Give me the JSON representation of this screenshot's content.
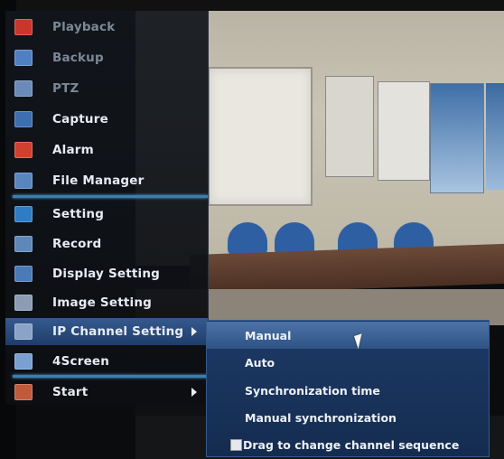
{
  "main_menu": {
    "items": [
      {
        "label": "Playback",
        "icon": "playback-icon",
        "color": "#c9362b"
      },
      {
        "label": "Backup",
        "icon": "backup-icon",
        "color": "#4f80c4"
      },
      {
        "label": "PTZ",
        "icon": "ptz-icon",
        "color": "#6a8bb8"
      },
      {
        "label": "Capture",
        "icon": "capture-icon",
        "color": "#3d6eb2"
      },
      {
        "label": "Alarm",
        "icon": "alarm-icon",
        "color": "#d0402e"
      },
      {
        "label": "File Manager",
        "icon": "file-manager-icon",
        "color": "#5a86c0"
      },
      {
        "label": "Setting",
        "icon": "setting-icon",
        "color": "#2e7dc4"
      },
      {
        "label": "Record",
        "icon": "record-icon",
        "color": "#5e88b8"
      },
      {
        "label": "Display Setting",
        "icon": "display-setting-icon",
        "color": "#4a7ab8"
      },
      {
        "label": "Image Setting",
        "icon": "image-setting-icon",
        "color": "#8b9cb4"
      },
      {
        "label": "IP Channel Setting",
        "icon": "ip-channel-icon",
        "color": "#8aa3c6"
      },
      {
        "label": "4Screen",
        "icon": "four-screen-icon",
        "color": "#7aa0d0"
      },
      {
        "label": "Start",
        "icon": "start-icon",
        "color": "#c05a3a"
      }
    ]
  },
  "submenu": {
    "items": [
      {
        "label": "Manual"
      },
      {
        "label": "Auto"
      },
      {
        "label": "Synchronization time"
      },
      {
        "label": "Manual synchronization"
      },
      {
        "label": "Drag to change channel sequence"
      }
    ]
  },
  "colors": {
    "menu_bg": "#12161c",
    "selected": "#355a8f",
    "submenu_bg": "#1d3a66",
    "separator": "#3b7fb0"
  }
}
